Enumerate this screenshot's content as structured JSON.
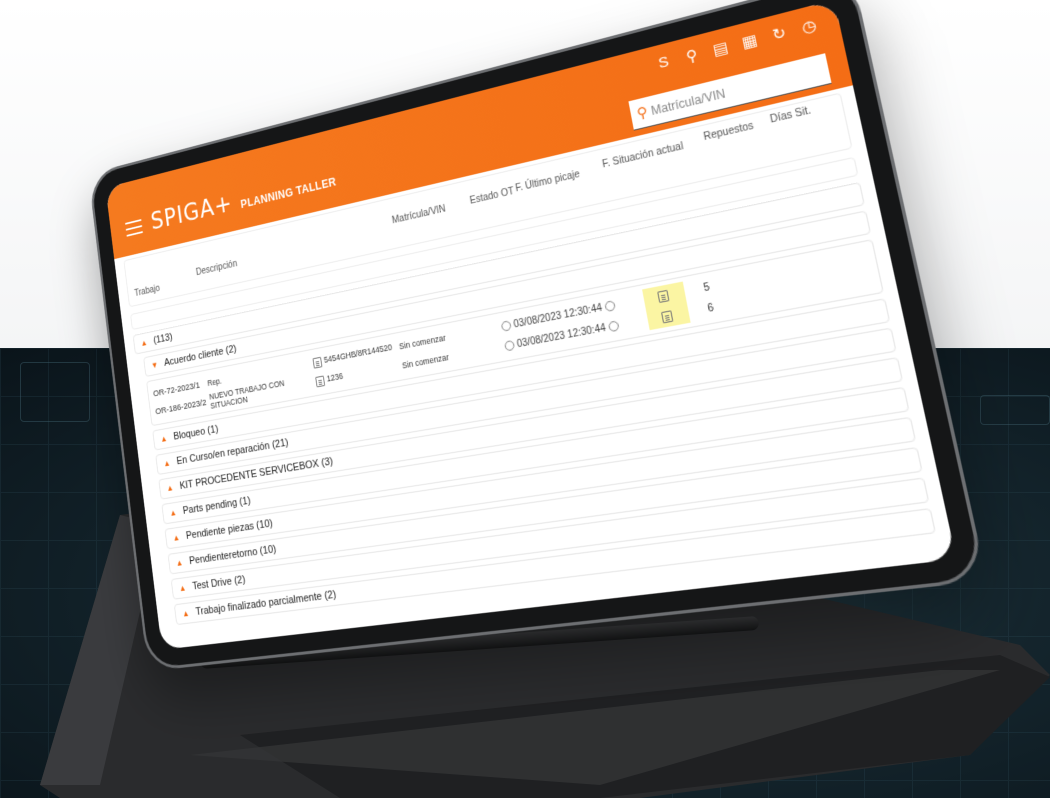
{
  "app": {
    "brand": "SPIGA+",
    "title": "PLANNING TALLER"
  },
  "header": {
    "icons": [
      "spiga-icon",
      "search-icon",
      "list-icon",
      "calendar-icon",
      "refresh-icon",
      "clock-icon"
    ],
    "search_placeholder": "Matrícula/VIN"
  },
  "columns": {
    "job": "Trabajo",
    "description": "Descripción",
    "plate": "Matrícula/VIN",
    "state": "Estado OT",
    "last_clock": "F. Último picaje",
    "current_status_date": "F. Situación actual",
    "parts": "Repuestos",
    "days": "Días Sit."
  },
  "root_group": {
    "label": "(113)"
  },
  "expanded_group": {
    "label": "Acuerdo cliente (2)",
    "rows": [
      {
        "job": "OR-72-2023/1",
        "description": "Rep.",
        "plate": "5454GHB/8R144520",
        "state": "Sin comenzar",
        "date": "03/08/2023 12:30:44",
        "days": "5"
      },
      {
        "job": "OR-186-2023/2",
        "description": "NUEVO TRABAJO CON SITUACION",
        "plate": "1236",
        "state": "Sin comenzar",
        "date": "03/08/2023 12:30:44",
        "days": "6"
      }
    ]
  },
  "groups": [
    {
      "label": "Bloqueo (1)"
    },
    {
      "label": "En Curso/en reparación (21)"
    },
    {
      "label": "KIT PROCEDENTE SERVICEBOX (3)"
    },
    {
      "label": "Parts pending (1)"
    },
    {
      "label": "Pendiente piezas (10)"
    },
    {
      "label": "Pendienteretorno (10)"
    },
    {
      "label": "Test Drive (2)"
    },
    {
      "label": "Trabajo finalizado parcialmente (2)"
    }
  ],
  "colors": {
    "accent": "#f46d15",
    "highlight": "#fbf5a3",
    "background_dark": "#14252d"
  }
}
